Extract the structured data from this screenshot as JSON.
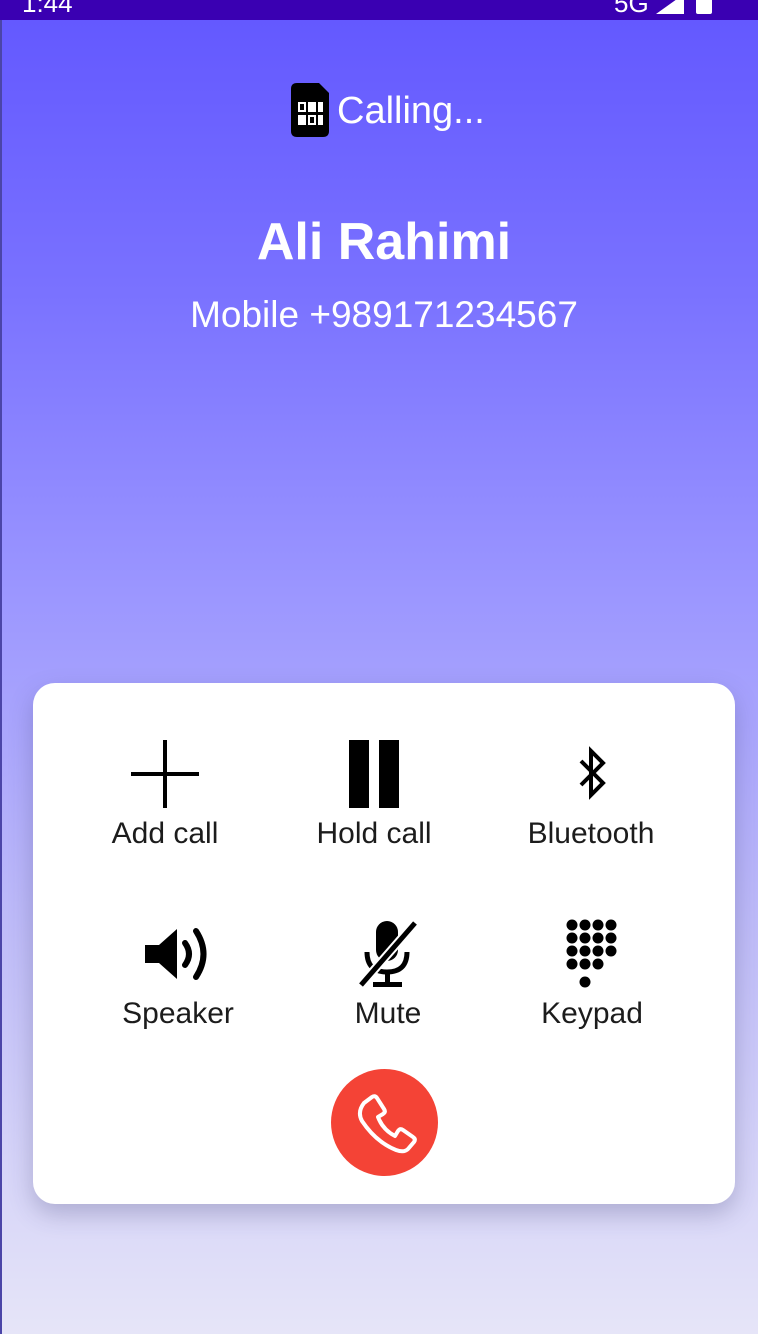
{
  "status_bar": {
    "time": "1:44",
    "network": "5G",
    "icons": [
      "signal-icon",
      "battery-icon"
    ]
  },
  "header": {
    "calling_text": "Calling...",
    "sim_icon": "sim-card-icon"
  },
  "contact": {
    "name": "Ali Rahimi",
    "number": "Mobile +989171234567"
  },
  "controls": [
    {
      "label": "Add call",
      "icon": "add-icon"
    },
    {
      "label": "Hold call",
      "icon": "pause-icon"
    },
    {
      "label": "Bluetooth",
      "icon": "bluetooth-icon"
    },
    {
      "label": "Speaker",
      "icon": "speaker-icon"
    },
    {
      "label": "Mute",
      "icon": "microphone-off-icon"
    },
    {
      "label": "Keypad",
      "icon": "dialpad-icon"
    }
  ],
  "end_call": {
    "icon": "phone-icon"
  },
  "colors": {
    "status_bar": "#3a00b2",
    "gradient_top": "#6257ff",
    "gradient_bottom": "#e6e5f8",
    "card": "#ffffff",
    "end_call": "#f44336"
  }
}
